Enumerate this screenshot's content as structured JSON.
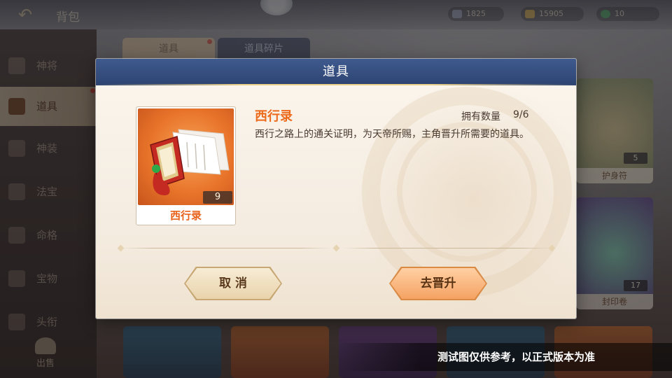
{
  "top_bar": {
    "back_icon": "back-arrow-icon",
    "title": "背包",
    "resources": [
      {
        "icon": "diamond-icon",
        "value": "1825",
        "color": "#9aa6c0"
      },
      {
        "icon": "gold-ingot-icon",
        "value": "15905",
        "color": "#e2b33f"
      },
      {
        "icon": "green-gem-icon",
        "value": "10",
        "color": "#3fae5a"
      }
    ]
  },
  "sidebar": {
    "items": [
      {
        "label": "神将",
        "icon": "helmet-icon"
      },
      {
        "label": "道具",
        "icon": "pouch-icon",
        "active": true
      },
      {
        "label": "神装",
        "icon": "armor-icon"
      },
      {
        "label": "法宝",
        "icon": "treasure-icon"
      },
      {
        "label": "命格",
        "icon": "fate-icon"
      },
      {
        "label": "宝物",
        "icon": "relic-icon"
      },
      {
        "label": "头衔",
        "icon": "title-icon"
      }
    ],
    "sell_label": "出售"
  },
  "background_tabs": [
    {
      "label": "道具"
    },
    {
      "label": "道具碎片"
    }
  ],
  "background_cards": [
    {
      "name": "护身符",
      "count": "5"
    },
    {
      "name": "封印卷",
      "count": "17"
    }
  ],
  "dialog": {
    "title": "道具",
    "item": {
      "name": "西行录",
      "card_name": "西行录",
      "count": "9",
      "own_label": "拥有数量",
      "own_value": "9/6",
      "description": "西行之路上的通关证明，为天帝所赐，主角晋升所需要的道具。",
      "art_icon": "scroll-book-icon"
    },
    "buttons": {
      "cancel": "取 消",
      "confirm": "去晋升"
    }
  },
  "watermark": "测试图仅供参考，以正式版本为准"
}
